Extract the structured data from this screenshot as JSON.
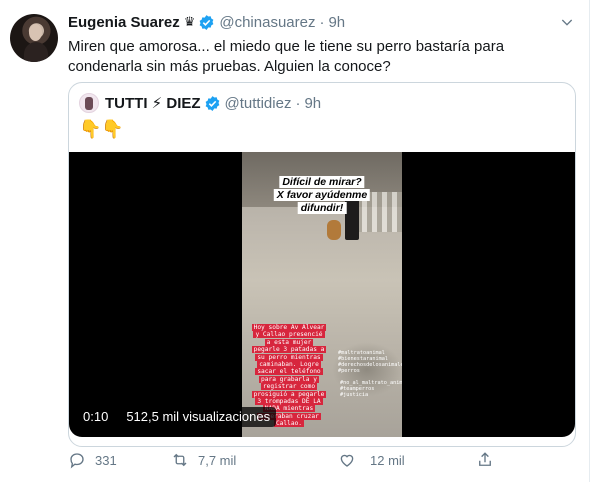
{
  "tweet": {
    "author_name": "Eugenia Suarez",
    "badge_glyph": "♛",
    "handle": "@chinasuarez",
    "separator": "·",
    "time": "9h",
    "text": "Miren que amorosa... el miedo que le tiene su perro bastaría para condenarla sin más pruebas. Alguien la conoce?"
  },
  "quote": {
    "author_name": "TUTTI ⚡ DIEZ",
    "handle": "@tuttidiez",
    "separator": "·",
    "time": "9h",
    "text": "👇👇",
    "video": {
      "overlay_lines": [
        "Difícil de mirar?",
        "X favor ayúdenme",
        "difundir!"
      ],
      "caption_lines": [
        "Hoy sobre Av Alvear",
        "y Callao presencié",
        "a esta mujer",
        "pegarle 3 patadas a",
        "su perro mientras",
        "caminaban. Logre",
        "sacar el teléfono",
        "para grabarla y",
        "registrar como",
        "prosiguió a pegarle",
        "3 trompadas DE LA",
        "NADA mientras",
        "esperaban cruzar",
        "Callao."
      ],
      "tag_lines": [
        "#maltratoanimal",
        "#bienestaranimal",
        "#derechosdelosanimales",
        "#perros"
      ],
      "tag_lines_2": [
        "#no_al_maltrato_animal",
        "#teamperros",
        "#justicia"
      ],
      "duration": "0:10",
      "views": "512,5 mil visualizaciones"
    }
  },
  "actions": {
    "replies": "331",
    "retweets": "7,7 mil",
    "likes": "12 mil"
  },
  "colors": {
    "verified": "#1da1f2",
    "muted": "#657786",
    "caption_bg": "#d7263d"
  },
  "icons": [
    "verified-icon",
    "caret-down-icon",
    "reply-icon",
    "retweet-icon",
    "like-icon",
    "share-icon"
  ]
}
